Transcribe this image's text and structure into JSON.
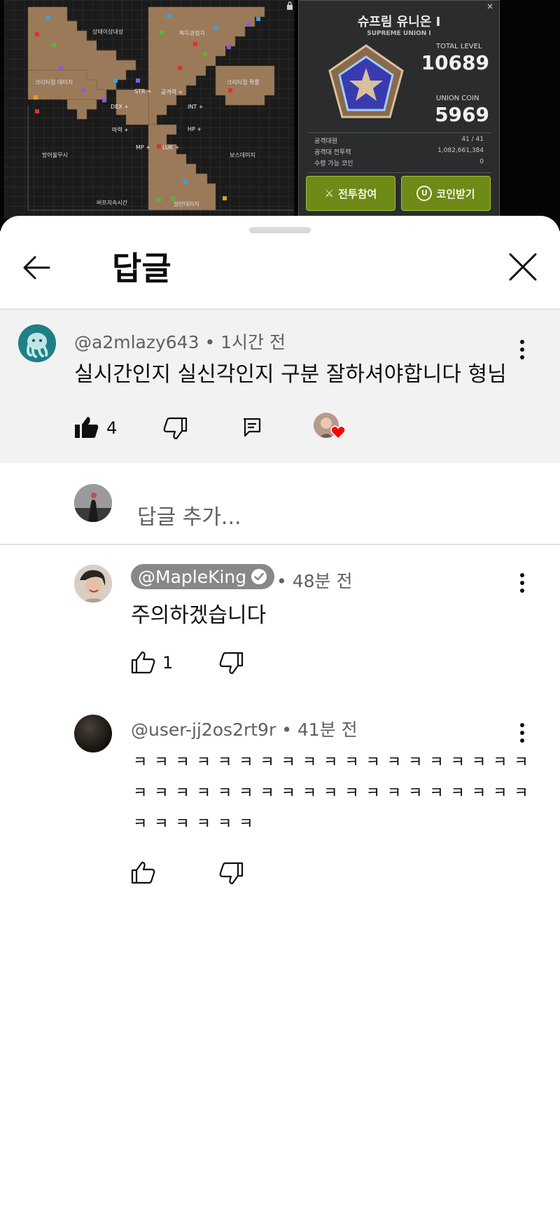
{
  "game": {
    "map_labels": [
      "상태이상내성",
      "획득경험치",
      "크리티컬 데미지",
      "크리티컬 확률",
      "방어율무시",
      "보스데미지",
      "버프지속시간",
      "일반데미지"
    ],
    "map_stats": [
      "DEX +",
      "STR +",
      "INT +",
      "HP +",
      "MP +",
      "LUK +",
      "마력 +",
      "공격력 +"
    ],
    "union_title": "슈프림 유니온 Ⅰ",
    "union_subtitle": "SUPREME UNION Ⅰ",
    "total_level_label": "TOTAL LEVEL",
    "total_level_value": "10689",
    "union_coin_label": "UNION COIN",
    "union_coin_value": "5969",
    "table": [
      {
        "label": "공격대원",
        "value": "41 / 41"
      },
      {
        "label": "공격대 전투력",
        "value": "1,082,661,384"
      },
      {
        "label": "수령 가능 코인",
        "value": "0"
      }
    ],
    "btn_battle": "전투참여",
    "btn_coin": "코인받기",
    "close": "×"
  },
  "sheet": {
    "title": "답글",
    "back_icon": "arrow-left-icon",
    "close_icon": "close-icon"
  },
  "parent_comment": {
    "author": "@a2mlazy643",
    "time": "1시간 전",
    "text": "실시간인지 실신각인지 구분 잘하셔야합니다 형님",
    "likes": "4"
  },
  "add_reply": {
    "placeholder": "답글 추가..."
  },
  "replies": [
    {
      "author": "@MapleKing",
      "verified": true,
      "time": "48분 전",
      "text": "주의하겠습니다",
      "likes": "1"
    },
    {
      "author": "@user-jj2os2rt9r",
      "time": "41분 전",
      "lines": [
        "ㅋㅋㅋㅋㅋㅋㅋㅋㅋㅋㅋㅋㅋㅋㅋㅋㅋㅋㅋ",
        "ㅋㅋㅋㅋㅋㅋㅋㅋㅋㅋㅋㅋㅋㅋㅋㅋㅋㅋㅋ",
        "ㅋㅋㅋㅋㅋㅋ"
      ],
      "likes": ""
    }
  ],
  "colors": {
    "accent_red": "#ff0000",
    "map_tile": "#9b7a5a",
    "game_button": "#6f8a17",
    "parent_bg": "#f2f2f2"
  }
}
